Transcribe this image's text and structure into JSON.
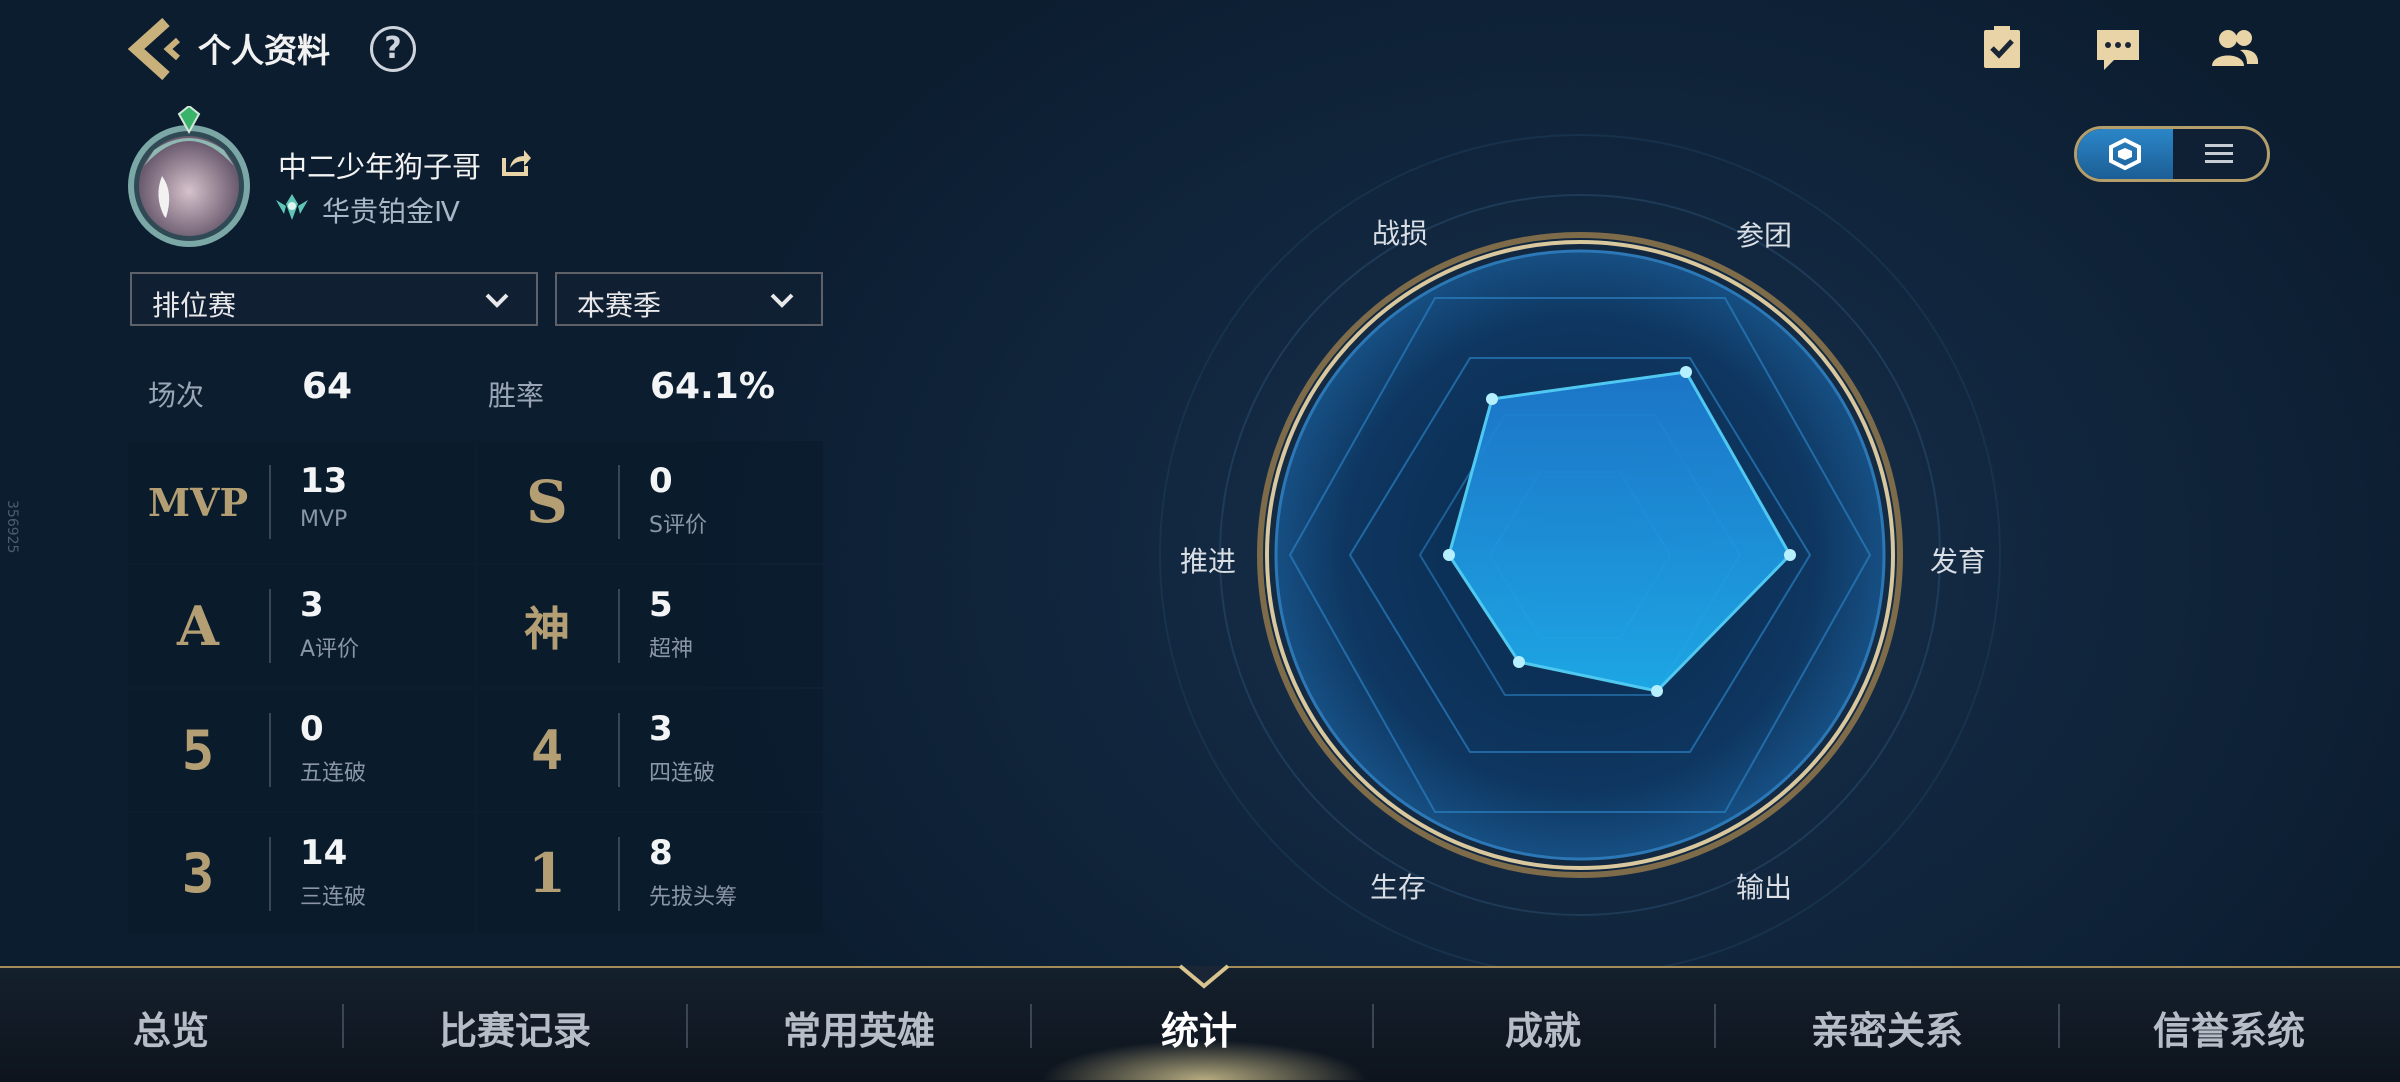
{
  "header": {
    "title": "个人资料",
    "help": "?",
    "icons": [
      "task-icon",
      "chat-icon",
      "friends-icon"
    ]
  },
  "profile": {
    "name": "中二少年狗子哥",
    "rank": "华贵铂金Ⅳ"
  },
  "filters": {
    "mode": "排位赛",
    "season": "本赛季"
  },
  "summary": {
    "matches_label": "场次",
    "matches_value": "64",
    "winrate_label": "胜率",
    "winrate_value": "64.1%"
  },
  "stats": [
    {
      "badge": "MVP",
      "value": "13",
      "label": "MVP"
    },
    {
      "badge": "S",
      "value": "0",
      "label": "S评价"
    },
    {
      "badge": "A",
      "value": "3",
      "label": "A评价"
    },
    {
      "badge": "神",
      "value": "5",
      "label": "超神"
    },
    {
      "badge": "5",
      "value": "0",
      "label": "五连破"
    },
    {
      "badge": "4",
      "value": "3",
      "label": "四连破"
    },
    {
      "badge": "3",
      "value": "14",
      "label": "三连破"
    },
    {
      "badge": "1",
      "value": "8",
      "label": "先拔头筹"
    }
  ],
  "radar": {
    "labels": {
      "top_left": "战损",
      "top_right": "参团",
      "right": "发育",
      "bottom_right": "输出",
      "bottom_left": "生存",
      "left": "推进"
    },
    "fill_color": "#1e8fe0",
    "stroke_color": "#4fd1ff"
  },
  "tabs": [
    {
      "label": "总览",
      "active": false
    },
    {
      "label": "比赛记录",
      "active": false
    },
    {
      "label": "常用英雄",
      "active": false
    },
    {
      "label": "统计",
      "active": true
    },
    {
      "label": "成就",
      "active": false
    },
    {
      "label": "亲密关系",
      "active": false
    },
    {
      "label": "信誉系统",
      "active": false
    }
  ],
  "side_id": "356925"
}
